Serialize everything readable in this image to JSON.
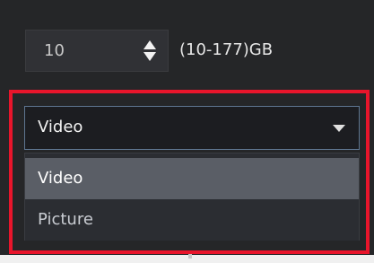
{
  "storage": {
    "size_value": "10",
    "range_label": "(10-177)GB"
  },
  "media_type": {
    "selected_value": "Video",
    "options": [
      {
        "label": "Video",
        "highlighted": true
      },
      {
        "label": "Picture",
        "highlighted": false
      }
    ]
  },
  "colors": {
    "background": "#252628",
    "highlight_frame": "#e8152b",
    "select_border": "#5e7590",
    "option_hover": "#5a5e66"
  },
  "icons": {
    "spinner": "up-down-arrows-icon",
    "select": "caret-down-icon"
  }
}
